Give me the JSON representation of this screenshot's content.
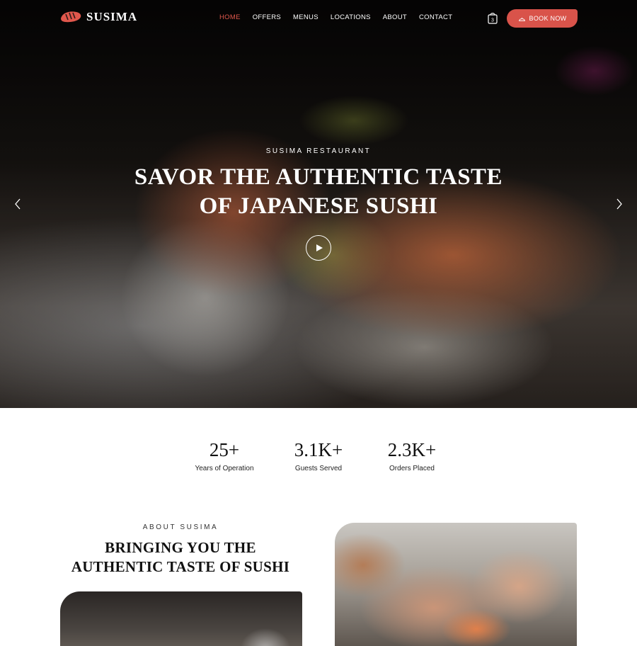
{
  "brand": {
    "name": "SUSIMA",
    "accent_color": "#d9534a"
  },
  "nav": {
    "items": [
      {
        "label": "HOME",
        "active": true
      },
      {
        "label": "OFFERS",
        "active": false
      },
      {
        "label": "MENUS",
        "active": false
      },
      {
        "label": "LOCATIONS",
        "active": false
      },
      {
        "label": "ABOUT",
        "active": false
      },
      {
        "label": "CONTACT",
        "active": false
      }
    ],
    "cart_count": "3",
    "book_label": "BOOK NOW"
  },
  "hero": {
    "kicker": "SUSIMA RESTAURANT",
    "title_line1": "SAVOR THE AUTHENTIC TASTE",
    "title_line2": "OF JAPANESE SUSHI",
    "icons": {
      "play": "play-icon",
      "prev": "chevron-left-icon",
      "next": "chevron-right-icon"
    }
  },
  "stats": [
    {
      "value": "25+",
      "label": "Years of Operation"
    },
    {
      "value": "3.1K+",
      "label": "Guests Served"
    },
    {
      "value": "2.3K+",
      "label": "Orders Placed"
    }
  ],
  "about": {
    "kicker": "ABOUT SUSIMA",
    "title_line1": "BRINGING YOU THE",
    "title_line2": "AUTHENTIC TASTE OF SUSHI"
  }
}
